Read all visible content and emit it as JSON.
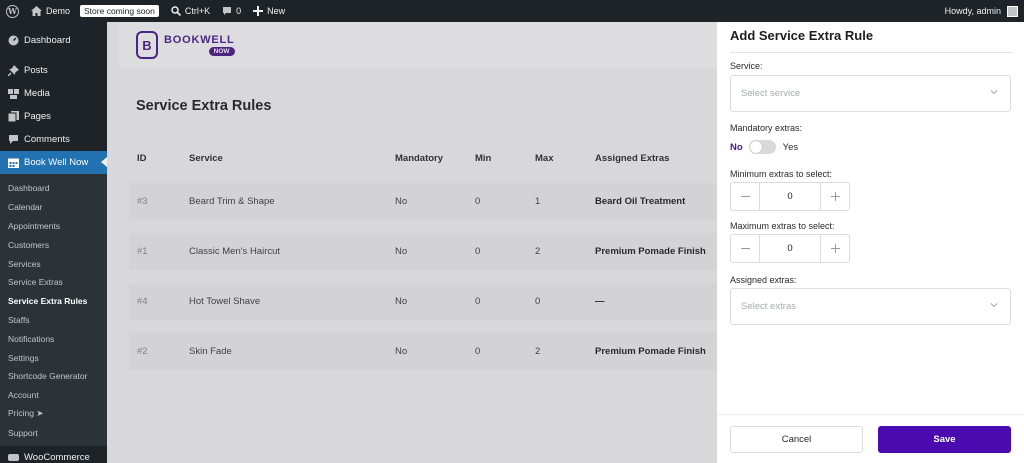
{
  "adminbar": {
    "site_name": "Demo",
    "store_badge": "Store coming soon",
    "shortcut": "Ctrl+K",
    "comments_count": "0",
    "new_label": "New",
    "howdy": "Howdy, admin"
  },
  "sidebar": {
    "top_items": [
      {
        "label": "Dashboard",
        "icon": "dashboard-icon"
      },
      {
        "label": "Posts",
        "icon": "pin-icon"
      },
      {
        "label": "Media",
        "icon": "media-icon"
      },
      {
        "label": "Pages",
        "icon": "pages-icon"
      },
      {
        "label": "Comments",
        "icon": "comment-icon"
      },
      {
        "label": "Book Well Now",
        "icon": "calendar-icon"
      }
    ],
    "sub_items": [
      "Dashboard",
      "Calendar",
      "Appointments",
      "Customers",
      "Services",
      "Service Extras",
      "Service Extra Rules",
      "Staffs",
      "Notifications",
      "Settings",
      "Shortcode Generator",
      "Account",
      "Pricing ➤",
      "Support"
    ],
    "cut_item": "WooCommerce"
  },
  "brand": {
    "name": "BOOKWELL",
    "tag": "NOW",
    "mark": "B"
  },
  "page": {
    "title": "Service Extra Rules"
  },
  "table": {
    "headers": {
      "id": "ID",
      "service": "Service",
      "mandatory": "Mandatory",
      "min": "Min",
      "max": "Max",
      "extras": "Assigned Extras"
    },
    "rows": [
      {
        "id": "#3",
        "service": "Beard Trim & Shape",
        "mandatory": "No",
        "min": "0",
        "max": "1",
        "extras": "Beard Oil Treatment"
      },
      {
        "id": "#1",
        "service": "Classic Men's Haircut",
        "mandatory": "No",
        "min": "0",
        "max": "2",
        "extras": "Premium Pomade Finish"
      },
      {
        "id": "#4",
        "service": "Hot Towel Shave",
        "mandatory": "No",
        "min": "0",
        "max": "0",
        "extras": "—"
      },
      {
        "id": "#2",
        "service": "Skin Fade",
        "mandatory": "No",
        "min": "0",
        "max": "2",
        "extras": "Premium Pomade Finish"
      }
    ]
  },
  "panel": {
    "title": "Add Service Extra Rule",
    "service_label": "Service:",
    "service_placeholder": "Select service",
    "mandatory_label": "Mandatory extras:",
    "toggle_no": "No",
    "toggle_yes": "Yes",
    "toggle_on": false,
    "min_label": "Minimum extras to select:",
    "min_value": "0",
    "max_label": "Maximum extras to select:",
    "max_value": "0",
    "assigned_label": "Assigned extras:",
    "assigned_placeholder": "Select extras",
    "cancel": "Cancel",
    "save": "Save"
  },
  "colors": {
    "accent": "#4b0ab0",
    "wp_blue": "#2271b1",
    "admin_dark": "#1d2327"
  }
}
